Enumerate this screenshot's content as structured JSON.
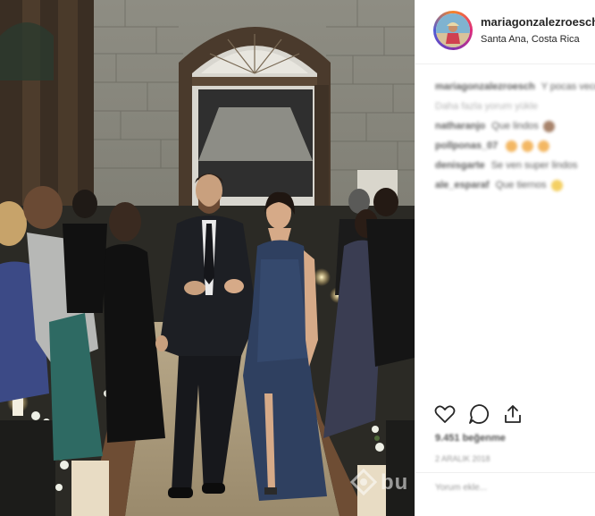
{
  "post": {
    "username": "mariagonzalezroesch",
    "location": "Santa Ana, Costa Rica",
    "caption": {
      "user": "mariagonzalezroesch",
      "text": "Y pocas veces estuvimos asi, pero como"
    },
    "more_comments": "Daha fazla yorum yükle",
    "comments": [
      {
        "user": "natharanjo",
        "text": "Que lindos"
      },
      {
        "user": "pollponas_07",
        "text": ""
      },
      {
        "user": "denisgarte",
        "text": "Se ven super lindos"
      },
      {
        "user": "ale_esparaf",
        "text": "Que tiernos"
      }
    ],
    "likes": "9.451 beğenme",
    "date": "2 ARALIK 2018",
    "comment_placeholder": "Yorum ekle..."
  },
  "icons": {
    "like": "heart-icon",
    "comment": "comment-icon",
    "share": "share-icon",
    "watermark": "bu-logo-icon"
  },
  "watermark": {
    "text": "bu"
  },
  "colors": {
    "avatar_ring": "#dd2a7b",
    "emoji_orange": "#f0a030",
    "emoji_brown": "#8a5a3a",
    "text": "#262626",
    "muted": "#999999"
  }
}
